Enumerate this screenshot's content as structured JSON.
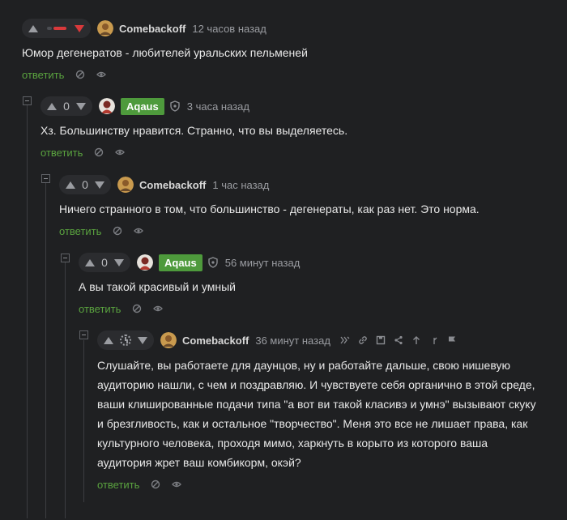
{
  "comments": [
    {
      "author": "Comebackoff",
      "time": "12 часов назад",
      "score": "",
      "text": "Юмор дегенератов - любителей уральских пельменей",
      "reply": "ответить"
    },
    {
      "author": "Aqaus",
      "time": "3 часа назад",
      "score": "0",
      "text": "Хз. Большинству нравится. Странно, что вы выделяетесь.",
      "reply": "ответить"
    },
    {
      "author": "Comebackoff",
      "time": "1 час назад",
      "score": "0",
      "text": "Ничего странного в том, что большинство - дегенераты, как раз нет. Это норма.",
      "reply": "ответить"
    },
    {
      "author": "Aqaus",
      "time": "56 минут назад",
      "score": "0",
      "text": "А вы такой красивый и умный",
      "reply": "ответить"
    },
    {
      "author": "Comebackoff",
      "time": "36 минут назад",
      "score": "",
      "text_lines": [
        "Слушайте, вы работаете для даунцов, ну и работайте дальше, свою нишевую",
        "аудиторию нашли, с чем и поздравляю. И чувствуете себя органично в этой среде,",
        "ваши клишированные подачи типа \"а вот ви такой класивэ и умнэ\" вызывают скуку",
        "и брезгливость, как и остальное \"творчество\". Меня это все не лишает права, как",
        "культурного человека, проходя мимо, харкнуть в корыто из которого ваша",
        "аудитория жрет ваш комбикорм, окэй?"
      ],
      "reply": "ответить"
    }
  ],
  "colors": {
    "accent_green": "#5aa33f",
    "downvote_red": "#d9393b",
    "badge_green": "#4e9a3c"
  }
}
